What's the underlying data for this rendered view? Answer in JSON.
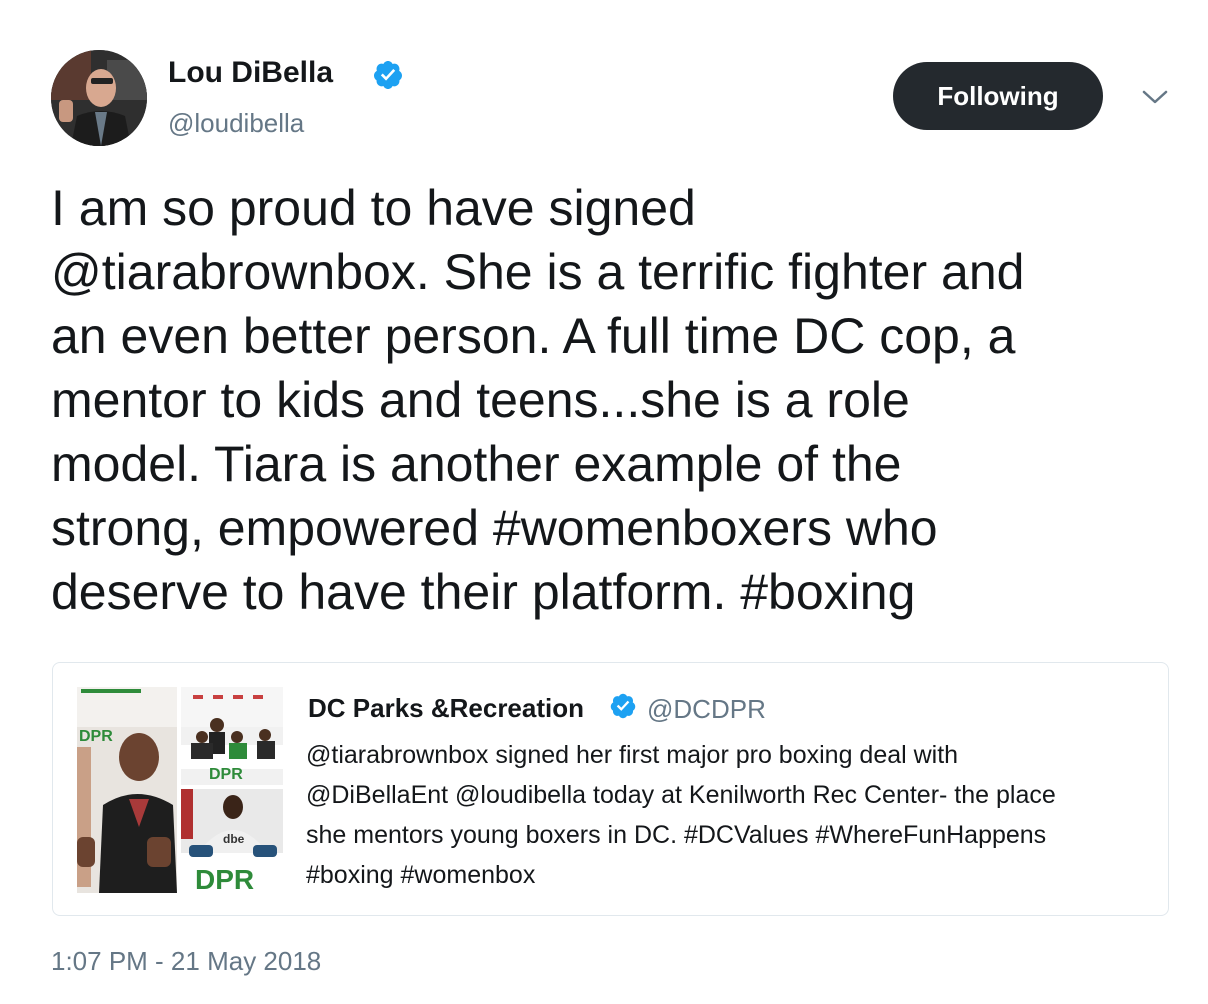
{
  "author": {
    "name": "Lou DiBella",
    "handle": "@loudibella",
    "verified_icon": "verified-badge-icon",
    "avatar_icon": "profile-photo"
  },
  "follow_button": {
    "label": "Following"
  },
  "menu": {
    "icon": "chevron-down-icon"
  },
  "tweet": {
    "lines": [
      "I am so proud to have signed",
      "@tiarabrownbox. She is a terrific fighter and",
      "an even better person. A full time DC cop, a",
      "mentor to kids and teens...she is a role",
      "model. Tiara is another example of the",
      "strong, empowered #womenboxers who",
      "deserve to have their platform. #boxing"
    ]
  },
  "quoted_tweet": {
    "name": "DC Parks &Recreation",
    "handle": "@DCDPR",
    "lines": [
      "@tiarabrownbox signed her first major pro boxing deal with",
      "@DiBellaEnt @loudibella today at Kenilworth Rec Center- the place",
      "she mentors young boxers in DC. #DCValues #WhereFunHappens",
      "#boxing #womenbox"
    ],
    "media": {
      "logo_text_large": "DPR",
      "logo_text_small": "DPR",
      "shirt_text": "dbe"
    }
  },
  "timestamp": "1:07 PM - 21 May 2018",
  "colors": {
    "text": "#14171a",
    "secondary_text": "#657786",
    "verified_blue": "#1da1f2",
    "follow_button_bg": "#24292e",
    "card_border": "#e1e8ed",
    "dpr_green": "#2e8b3a"
  }
}
